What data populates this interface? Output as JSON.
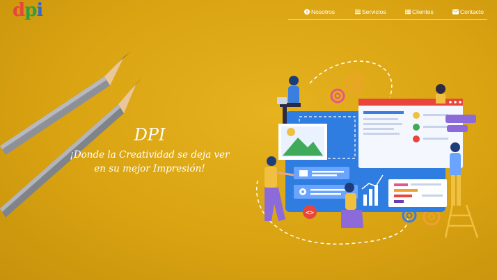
{
  "brand": {
    "logo_d": "d",
    "logo_p": "p",
    "logo_i": "i"
  },
  "nav": {
    "items": [
      {
        "label": "Nosotros",
        "icon": "info-circle-icon"
      },
      {
        "label": "Servicios",
        "icon": "bars-icon"
      },
      {
        "label": "Clientes",
        "icon": "list-icon"
      },
      {
        "label": "Contacto",
        "icon": "envelope-icon"
      }
    ]
  },
  "hero": {
    "title": "DPI",
    "subtitle_line1": "¡Donde la Creatividad se deja ver",
    "subtitle_line2": "en su mejor Impresión!"
  },
  "colors": {
    "background": "#d9a312",
    "accent_blue": "#2f7de1",
    "accent_red": "#e8453c"
  },
  "illustration": {
    "code_badge": "<>"
  }
}
